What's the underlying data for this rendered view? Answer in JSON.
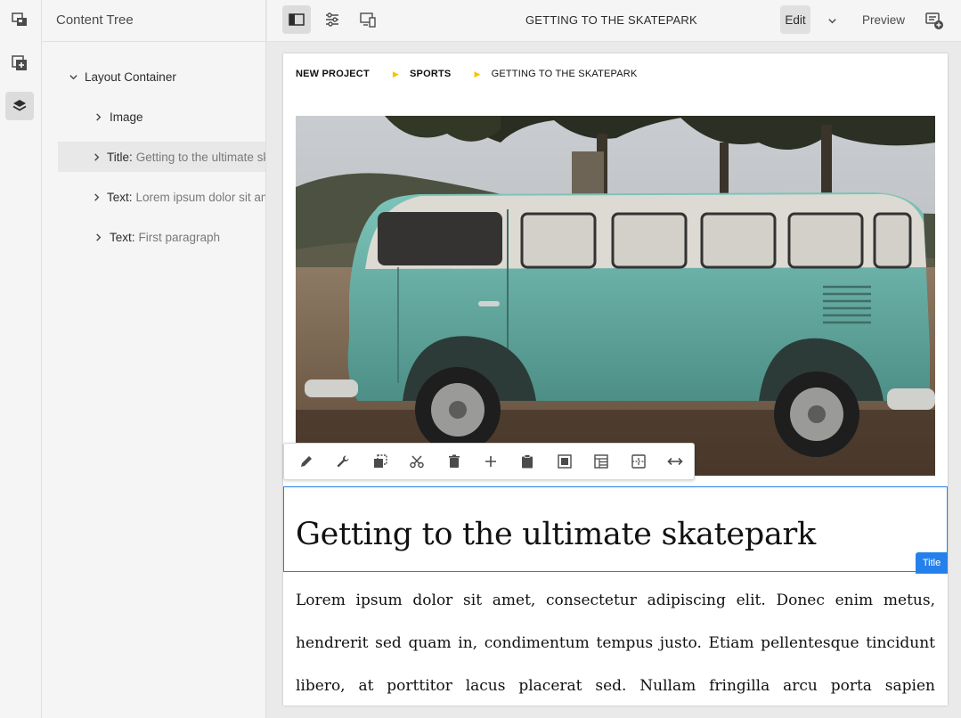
{
  "rail": {
    "items": [
      {
        "icon": "component-browser-icon"
      },
      {
        "icon": "add-asset-icon"
      },
      {
        "icon": "layers-icon",
        "active": true
      }
    ]
  },
  "panel": {
    "title": "Content Tree",
    "tree": [
      {
        "key": "Layout Container",
        "value": "",
        "expanded": true
      },
      {
        "key": "Image",
        "value": ""
      },
      {
        "key": "Title:",
        "value": "Getting to the ultimate skatepark",
        "selected": true
      },
      {
        "key": "Text:",
        "value": "Lorem ipsum dolor sit amet"
      },
      {
        "key": "Text:",
        "value": "First paragraph"
      }
    ]
  },
  "topbar": {
    "page_title": "GETTING TO THE SKATEPARK",
    "edit_label": "Edit",
    "preview_label": "Preview"
  },
  "breadcrumb": {
    "items": [
      "NEW PROJECT",
      "SPORTS",
      "GETTING TO THE SKATEPARK"
    ]
  },
  "toolbar": {
    "tools": [
      "edit-icon",
      "configure-icon",
      "copy-icon",
      "cut-icon",
      "delete-icon",
      "insert-icon",
      "paste-icon",
      "image-crop-icon",
      "layout-icon",
      "group-icon",
      "resize-icon"
    ]
  },
  "content": {
    "title": "Getting to the ultimate skatepark",
    "component_badge": "Title",
    "paragraph": "Lorem ipsum dolor sit amet, consectetur adipiscing elit. Donec enim metus, hendrerit sed quam in, condimentum tempus justo. Etiam pellentesque tincidunt libero, at porttitor lacus placerat sed. Nullam fringilla arcu porta sapien scelerisque"
  },
  "colors": {
    "accent": "#2680eb",
    "breadcrumb_separator": "#f5c400"
  }
}
